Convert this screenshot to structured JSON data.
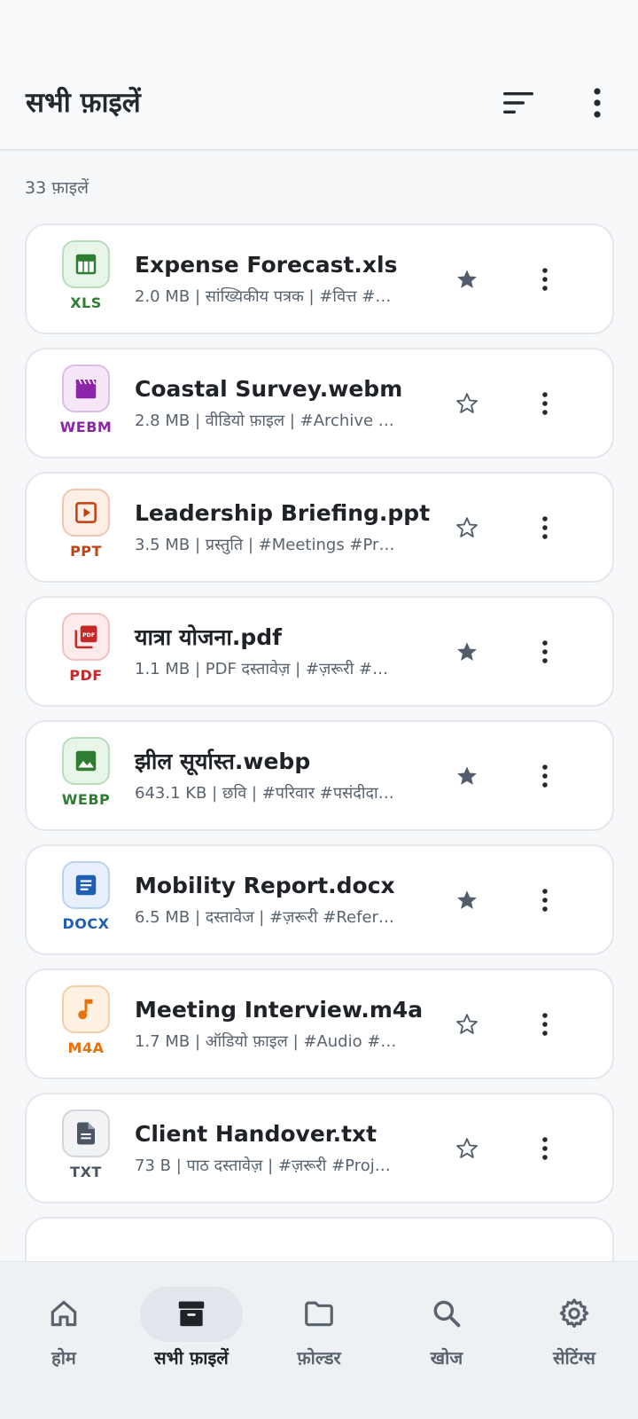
{
  "header": {
    "title": "सभी फ़ाइलें",
    "sort_icon": "sort-icon",
    "overflow_icon": "more-vert-icon"
  },
  "file_count": "33 फ़ाइलें",
  "files": [
    {
      "name": "Expense Forecast.xls",
      "meta": "2.0 MB | सांख्यिकीय पत्रक | #वित्त  #…",
      "ext": "XLS",
      "icon": "table-icon",
      "color": "#2e7d32",
      "tile_bg": "#e8f5e9",
      "tile_border": "#b9dcbd",
      "starred": true
    },
    {
      "name": "Coastal Survey.webm",
      "meta": "2.8 MB | वीडियो फ़ाइल | #Archive  …",
      "ext": "WEBM",
      "icon": "video-clapper-icon",
      "color": "#8e24aa",
      "tile_bg": "#f5e6f8",
      "tile_border": "#dcbde3",
      "starred": false
    },
    {
      "name": "Leadership Briefing.ppt",
      "meta": "3.5 MB | प्रस्तुति | #Meetings  #Pr…",
      "ext": "PPT",
      "icon": "slideshow-icon",
      "color": "#c2410c",
      "tile_bg": "#fdeee6",
      "tile_border": "#f1c7b3",
      "starred": false
    },
    {
      "name": "यात्रा योजना.pdf",
      "meta": "1.1 MB | PDF दस्तावेज़ | #ज़रूरी  #…",
      "ext": "PDF",
      "icon": "pdf-icon",
      "color": "#c62828",
      "tile_bg": "#fdeaea",
      "tile_border": "#f1c2c2",
      "starred": true
    },
    {
      "name": "झील सूर्यास्त.webp",
      "meta": "643.1 KB | छवि | #परिवार  #पसंदीदा…",
      "ext": "WEBP",
      "icon": "image-icon",
      "color": "#2e7d32",
      "tile_bg": "#e8f5e9",
      "tile_border": "#b9dcbd",
      "starred": true
    },
    {
      "name": "Mobility Report.docx",
      "meta": "6.5 MB | दस्तावेज | #ज़रूरी  #Refer…",
      "ext": "DOCX",
      "icon": "document-icon",
      "color": "#1e5fb3",
      "tile_bg": "#e7f0fc",
      "tile_border": "#bcd2ef",
      "starred": true
    },
    {
      "name": "Meeting Interview.m4a",
      "meta": "1.7 MB | ऑडियो फ़ाइल | #Audio  #…",
      "ext": "M4A",
      "icon": "music-note-icon",
      "color": "#e8710a",
      "tile_bg": "#fff1e2",
      "tile_border": "#f5cfa6",
      "starred": false
    },
    {
      "name": "Client Handover.txt",
      "meta": "73 B | पाठ दस्तावेज़ | #ज़रूरी  #Proj…",
      "ext": "TXT",
      "icon": "text-file-icon",
      "color": "#4b5563",
      "tile_bg": "#f1f3f5",
      "tile_border": "#d3d7dc",
      "starred": false
    }
  ],
  "nav": [
    {
      "label": "होम",
      "icon": "home-icon",
      "active": false
    },
    {
      "label": "सभी फ़ाइलें",
      "icon": "archive-icon",
      "active": true
    },
    {
      "label": "फ़ोल्डर",
      "icon": "folder-icon",
      "active": false
    },
    {
      "label": "खोज",
      "icon": "search-icon",
      "active": false
    },
    {
      "label": "सेटिंग्स",
      "icon": "settings-icon",
      "active": false
    }
  ]
}
